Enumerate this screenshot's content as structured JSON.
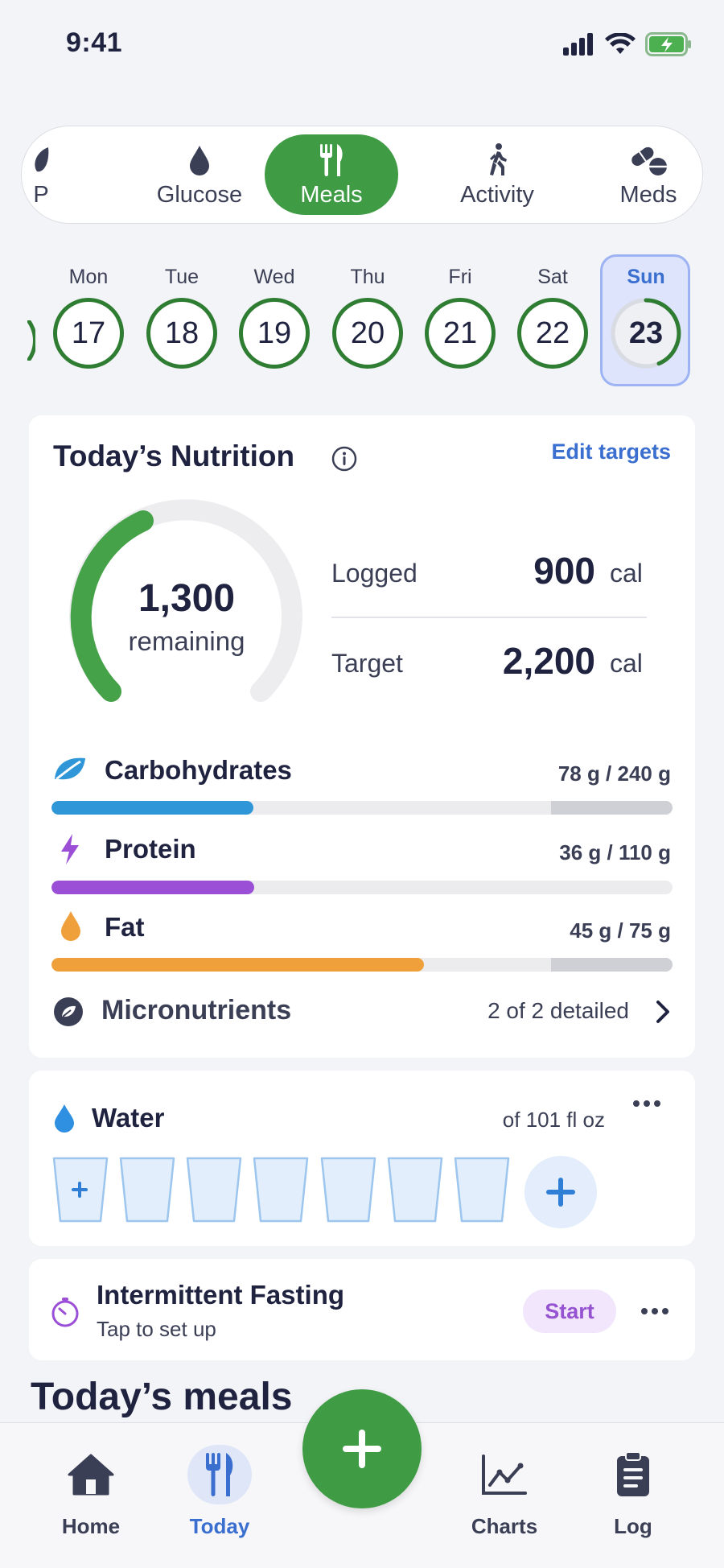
{
  "status_bar": {
    "time": "9:41"
  },
  "categories": {
    "partial": "P",
    "items": [
      {
        "label": "Glucose",
        "icon": "drop-icon"
      },
      {
        "label": "Meals",
        "icon": "fork-knife-icon",
        "active": true
      },
      {
        "label": "Activity",
        "icon": "walking-icon"
      },
      {
        "label": "Meds",
        "icon": "pills-icon"
      }
    ]
  },
  "days": [
    {
      "name": "Mon",
      "num": "17"
    },
    {
      "name": "Tue",
      "num": "18"
    },
    {
      "name": "Wed",
      "num": "19"
    },
    {
      "name": "Thu",
      "num": "20"
    },
    {
      "name": "Fri",
      "num": "21"
    },
    {
      "name": "Sat",
      "num": "22"
    },
    {
      "name": "Sun",
      "num": "23",
      "selected": true
    }
  ],
  "nutrition": {
    "title": "Today’s Nutrition",
    "edit_label": "Edit targets",
    "remaining_value": "1,300",
    "remaining_label": "remaining",
    "logged_label": "Logged",
    "logged_value": "900",
    "target_label": "Target",
    "target_value": "2,200",
    "unit": "cal",
    "macros": [
      {
        "name": "Carbohydrates",
        "amount": "78 g / 240 g",
        "progress": 0.325,
        "color": "#2f97d8"
      },
      {
        "name": "Protein",
        "amount": "36 g / 110 g",
        "progress": 0.327,
        "color": "#9b4fd6"
      },
      {
        "name": "Fat",
        "amount": "45 g / 75 g",
        "progress": 0.6,
        "color": "#f0a03a"
      }
    ],
    "micro_label": "Micronutrients",
    "micro_count": "2 of 2 detailed"
  },
  "water": {
    "title": "Water",
    "of_label": "of 101 fl oz",
    "cups": 7
  },
  "fasting": {
    "title": "Intermittent Fasting",
    "subtitle": "Tap to set up",
    "start_label": "Start"
  },
  "meals_heading": "Today’s meals",
  "tabbar": {
    "items": [
      {
        "label": "Home",
        "icon": "home-icon"
      },
      {
        "label": "Today",
        "icon": "fork-knife-icon",
        "active": true
      },
      {
        "label": "Charts",
        "icon": "chart-icon"
      },
      {
        "label": "Log",
        "icon": "clipboard-icon"
      }
    ]
  },
  "colors": {
    "accent_green": "#3f9c45",
    "link_blue": "#3a6fd0"
  }
}
